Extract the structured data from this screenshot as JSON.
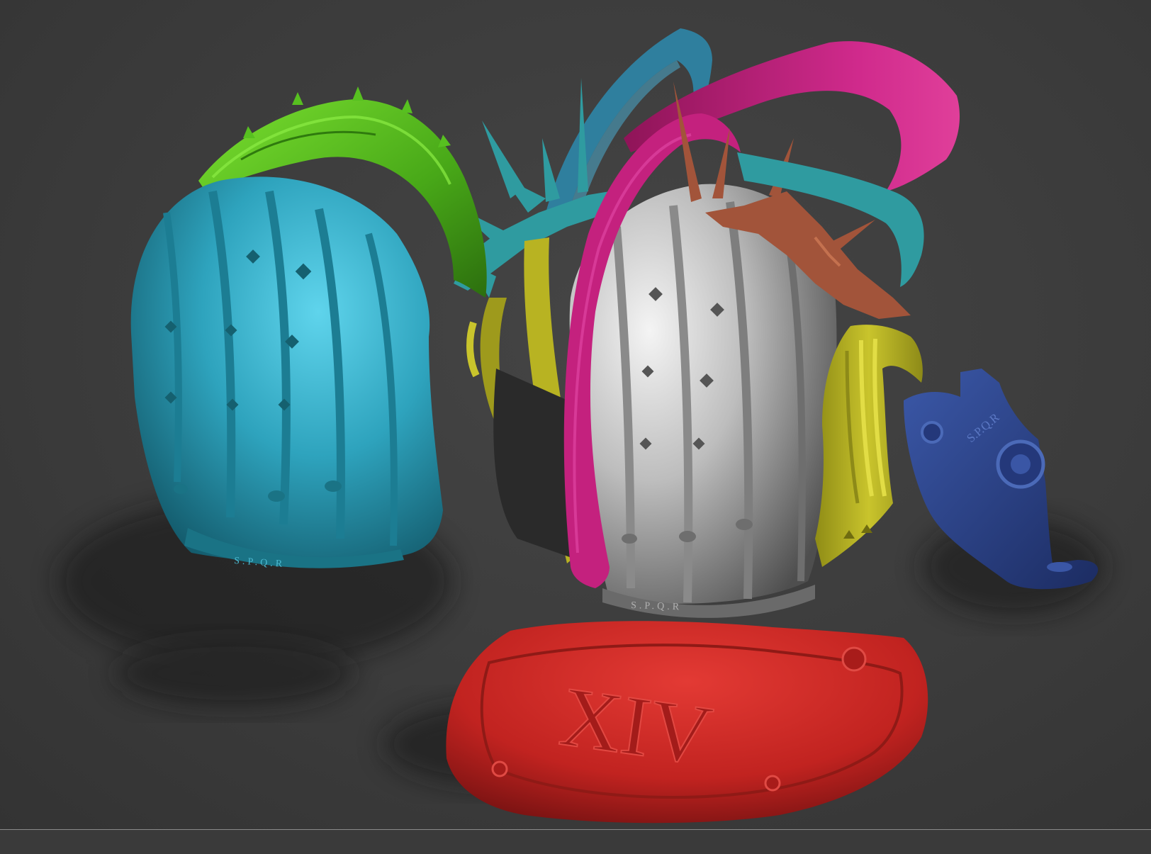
{
  "scene": {
    "background_color": "#3c3c3c",
    "parts": [
      {
        "name": "left-helmet-bowl",
        "color": "#2ea3bd"
      },
      {
        "name": "green-spiked-crest",
        "color": "#57c020"
      },
      {
        "name": "center-helmet-bowl",
        "color": "#9a9a9a"
      },
      {
        "name": "red-neck-guard",
        "color": "#cc2424"
      },
      {
        "name": "magenta-crest-arch",
        "color": "#c4217e"
      },
      {
        "name": "blue-teal-crest-arch",
        "color": "#2f7f9e"
      },
      {
        "name": "copper-spiked-crown",
        "color": "#a2543a"
      },
      {
        "name": "teal-spiked-crown",
        "color": "#2f9ba0"
      },
      {
        "name": "yellow-ear-guard",
        "color": "#b8b322"
      },
      {
        "name": "navy-cheek-guard",
        "color": "#2c4388"
      }
    ],
    "engravings": {
      "left_rim": "S.P.Q.R",
      "center_rim": "S.P.Q.R",
      "neck_guard": "XIV",
      "cheek_guard": "S.P.Q.R"
    }
  }
}
